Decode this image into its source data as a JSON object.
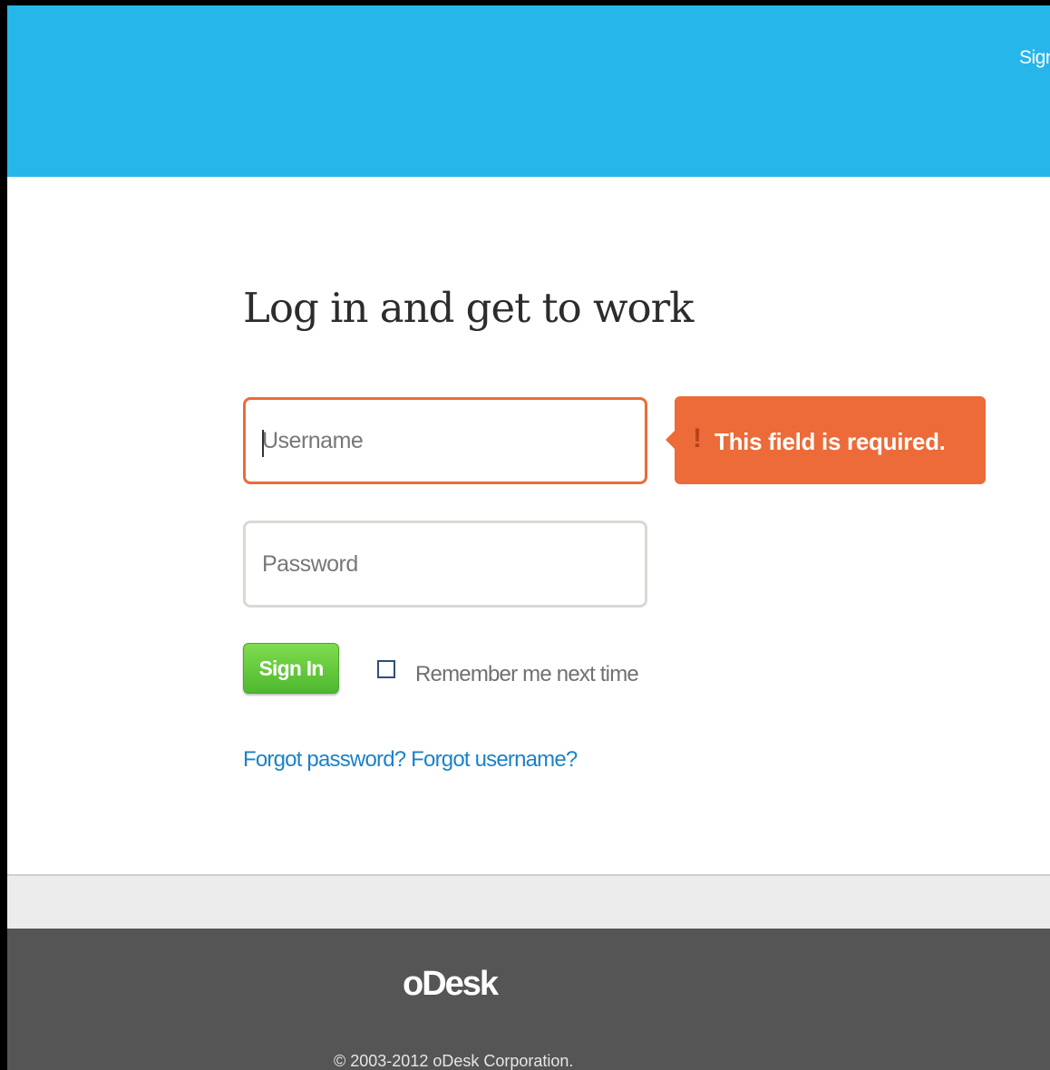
{
  "header": {
    "sign_link": "Sign"
  },
  "login": {
    "title": "Log in and get to work",
    "username_placeholder": "Username",
    "password_placeholder": "Password",
    "error_message": "This field is required.",
    "error_mark": "!",
    "sign_in_label": "Sign In",
    "remember_label": "Remember me next time",
    "remember_checked": false,
    "forgot_password": "Forgot password?",
    "forgot_username": "Forgot username?"
  },
  "footer": {
    "logo": "oDesk",
    "copyright": "© 2003-2012 oDesk Corporation."
  },
  "colors": {
    "header_bg": "#27b6e9",
    "error_accent": "#ec6b39",
    "button_green": "#5cc337",
    "link_blue": "#1c82c8",
    "footer_bg": "#555555"
  },
  "icons": {
    "error": "exclamation-icon",
    "caret": "text-cursor"
  }
}
